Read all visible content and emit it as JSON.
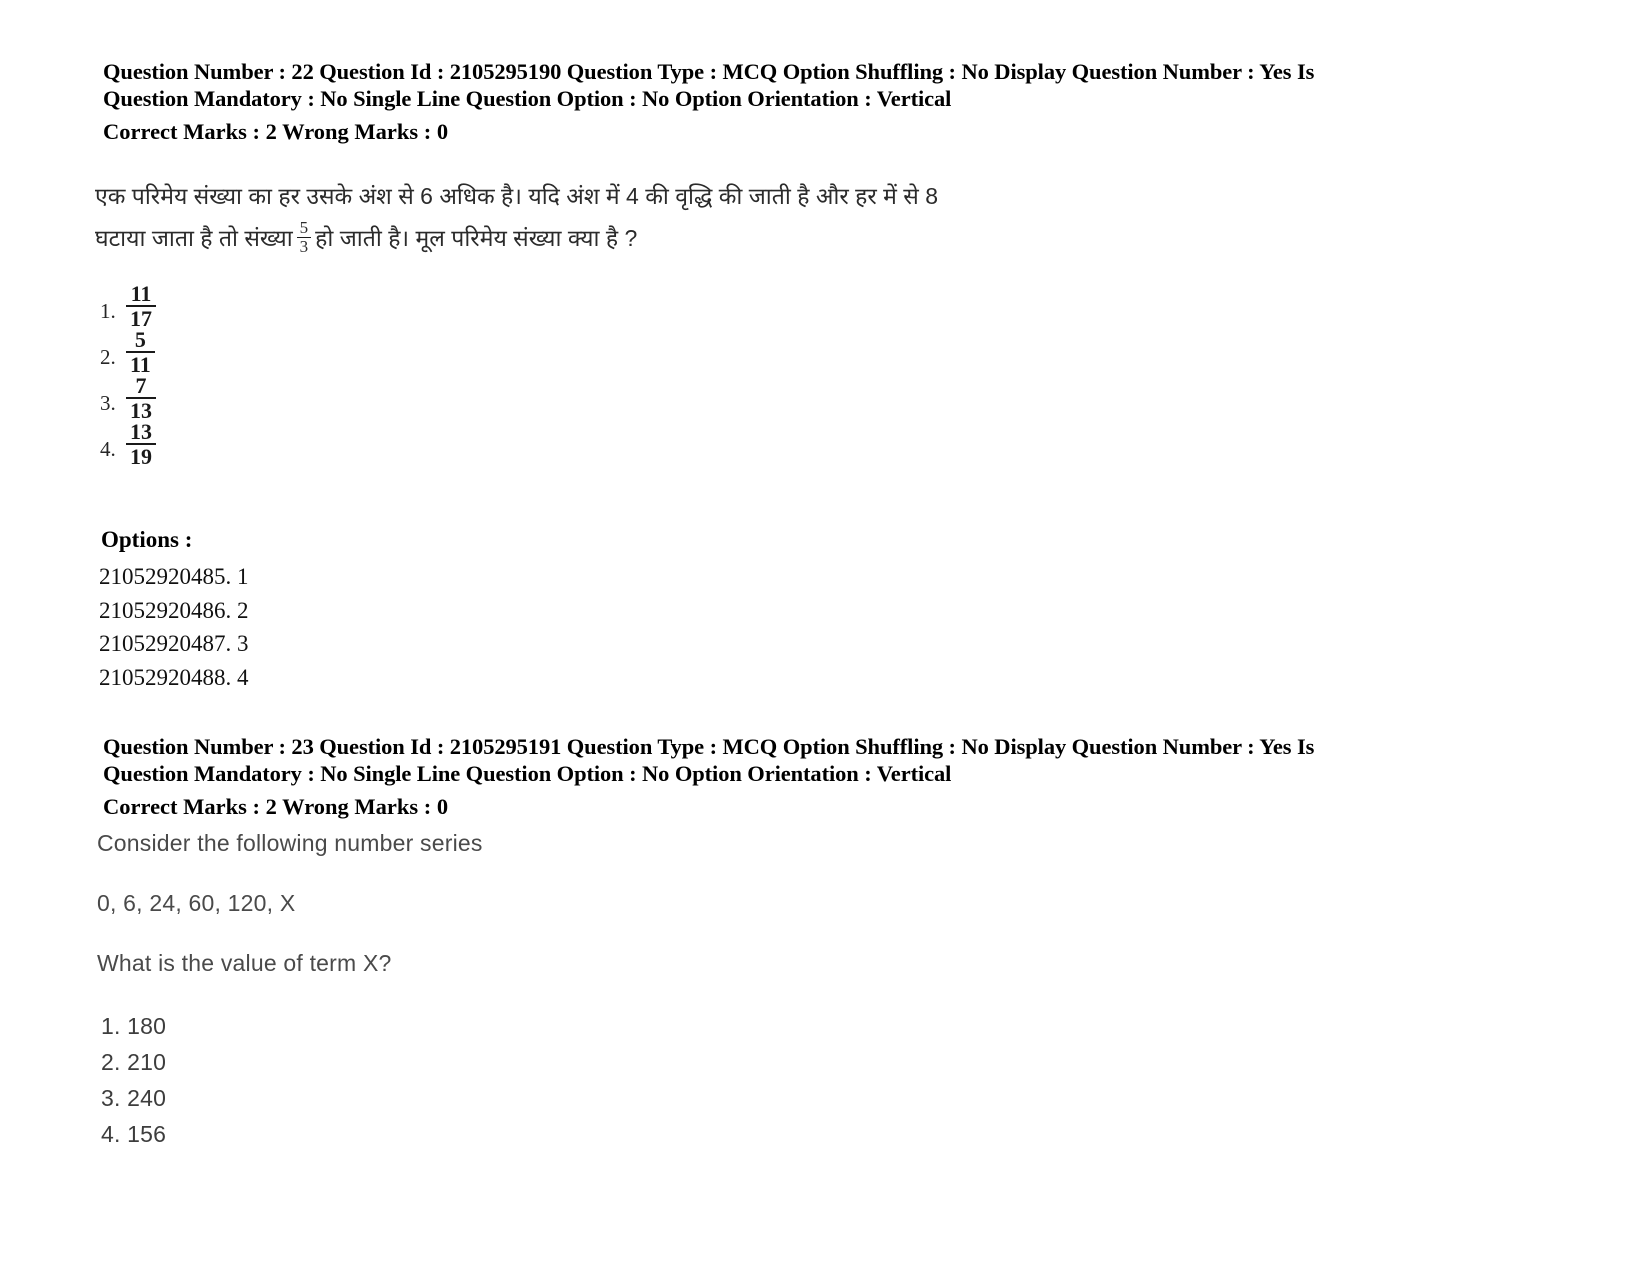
{
  "document": {
    "type": "exam-question-paper-scan"
  },
  "questions": [
    {
      "meta_line_1": "Question Number : 22 Question Id : 2105295190 Question Type : MCQ Option Shuffling : No Display Question Number : Yes Is",
      "meta_line_2": "Question Mandatory : No Single Line Question Option : No Option Orientation : Vertical",
      "marks_line": "Correct Marks : 2 Wrong Marks : 0",
      "body_lines": [
        {
          "before": "एक परिमेय संख्या का हर उसके अंश से 6 अधिक है। यदि अंश में 4 की वृद्धि की जाती है और हर में से 8",
          "after": ""
        },
        {
          "before": "घटाया जाता है तो संख्या",
          "fraction": {
            "numerator": "5",
            "denominator": "3"
          },
          "after": "हो जाती है। मूल परिमेय संख्या क्या है ?"
        }
      ],
      "choices": [
        {
          "label": "1.",
          "numerator": "11",
          "denominator": "17"
        },
        {
          "label": "2.",
          "numerator": "5",
          "denominator": "11"
        },
        {
          "label": "3.",
          "numerator": "7",
          "denominator": "13"
        },
        {
          "label": "4.",
          "numerator": "13",
          "denominator": "19"
        }
      ],
      "options_heading": "Options :",
      "option_ids": [
        "21052920485. 1",
        "21052920486. 2",
        "21052920487. 3",
        "21052920488. 4"
      ]
    },
    {
      "meta_line_1": "Question Number : 23 Question Id : 2105295191 Question Type : MCQ Option Shuffling : No Display Question Number : Yes Is",
      "meta_line_2": "Question Mandatory : No Single Line Question Option : No Option Orientation : Vertical",
      "marks_line": "Correct Marks : 2 Wrong Marks : 0",
      "body_lines": [
        "Consider the following number series",
        "0, 6, 24, 60, 120, X",
        "What is the value of term X?"
      ],
      "choices": [
        "1. 180",
        "2. 210",
        "3. 240",
        "4. 156"
      ]
    }
  ],
  "colors": {
    "page_background": "#ffffff",
    "heading_text": "#000000",
    "scanned_body_text": "#4a4a4a"
  }
}
